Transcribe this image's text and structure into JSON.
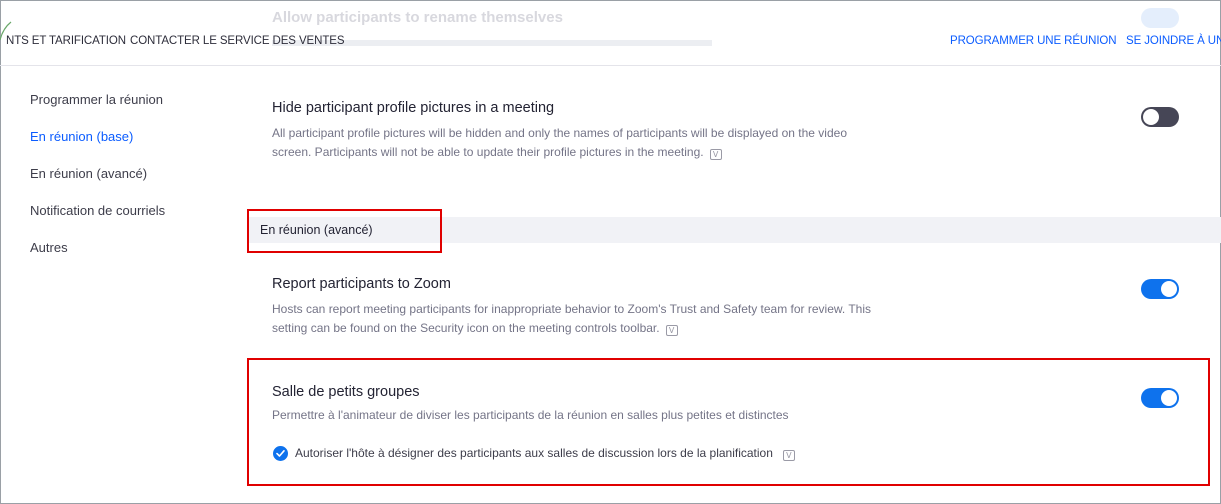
{
  "ghost": {
    "title": "Allow participants to rename themselves"
  },
  "topnav": {
    "left_links": [
      "NTS ET TARIFICATION",
      "CONTACTER LE SERVICE DES VENTES"
    ],
    "right_links": [
      "PROGRAMMER UNE RÉUNION",
      "SE JOINDRE À UN"
    ]
  },
  "sidebar": {
    "items": [
      {
        "label": "Programmer la réunion",
        "active": false
      },
      {
        "label": "En réunion (base)",
        "active": true
      },
      {
        "label": "En réunion (avancé)",
        "active": false
      },
      {
        "label": "Notification de courriels",
        "active": false
      },
      {
        "label": "Autres",
        "active": false
      }
    ]
  },
  "settings": {
    "hide_pictures": {
      "title": "Hide participant profile pictures in a meeting",
      "desc_line1": "All participant profile pictures will be hidden and only the names of participants will be displayed on the video",
      "desc_line2": "screen. Participants will not be able to update their profile pictures in the meeting.",
      "enabled": false
    },
    "section_header": "En réunion (avancé)",
    "report_participants": {
      "title": "Report participants to Zoom",
      "desc_line1": "Hosts can report meeting participants for inappropriate behavior to Zoom's Trust and Safety team for review. This",
      "desc_line2": "setting can be found on the Security icon on the meeting controls toolbar.",
      "enabled": true
    },
    "breakout_rooms": {
      "title": "Salle de petits groupes",
      "desc": "Permettre à l'animateur de diviser les participants de la réunion en salles plus petites et distinctes",
      "enabled": true,
      "option_label": "Autoriser l'hôte à désigner des participants aux salles de discussion lors de la planification",
      "option_checked": true
    }
  },
  "colors": {
    "accent": "#0e72ed",
    "link": "#0b5cff",
    "highlight": "#e00000",
    "toggle_off": "#464656"
  }
}
